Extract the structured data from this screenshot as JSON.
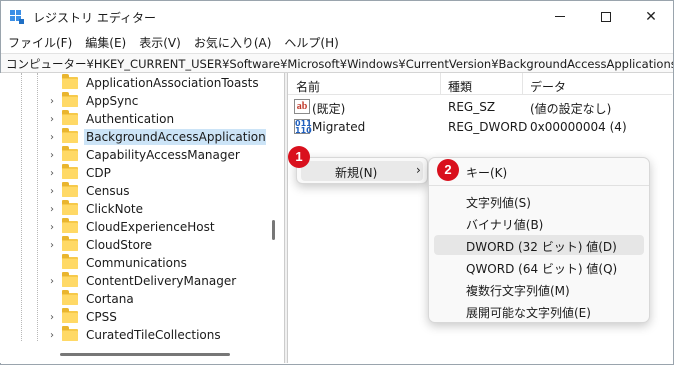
{
  "window": {
    "title": "レジストリ エディター"
  },
  "menubar": {
    "items": [
      "ファイル(F)",
      "編集(E)",
      "表示(V)",
      "お気に入り(A)",
      "ヘルプ(H)"
    ]
  },
  "address": {
    "path": "コンピューター¥HKEY_CURRENT_USER¥Software¥Microsoft¥Windows¥CurrentVersion¥BackgroundAccessApplications"
  },
  "tree": {
    "items": [
      {
        "label": "ApplicationAssociationToasts",
        "expandable": false,
        "selected": false
      },
      {
        "label": "AppSync",
        "expandable": true,
        "selected": false
      },
      {
        "label": "Authentication",
        "expandable": true,
        "selected": false
      },
      {
        "label": "BackgroundAccessApplications",
        "expandable": true,
        "selected": true
      },
      {
        "label": "CapabilityAccessManager",
        "expandable": true,
        "selected": false
      },
      {
        "label": "CDP",
        "expandable": true,
        "selected": false
      },
      {
        "label": "Census",
        "expandable": true,
        "selected": false
      },
      {
        "label": "ClickNote",
        "expandable": true,
        "selected": false
      },
      {
        "label": "CloudExperienceHost",
        "expandable": true,
        "selected": false
      },
      {
        "label": "CloudStore",
        "expandable": true,
        "selected": false
      },
      {
        "label": "Communications",
        "expandable": false,
        "selected": false
      },
      {
        "label": "ContentDeliveryManager",
        "expandable": true,
        "selected": false
      },
      {
        "label": "Cortana",
        "expandable": false,
        "selected": false
      },
      {
        "label": "CPSS",
        "expandable": true,
        "selected": false
      },
      {
        "label": "CuratedTileCollections",
        "expandable": true,
        "selected": false
      }
    ]
  },
  "list": {
    "columns": [
      "名前",
      "種類",
      "データ"
    ],
    "rows": [
      {
        "icon": "string-value-icon",
        "name": "(既定)",
        "type": "REG_SZ",
        "data": "(値の設定なし)"
      },
      {
        "icon": "binary-value-icon",
        "name": "Migrated",
        "type": "REG_DWORD",
        "data": "0x00000004 (4)"
      }
    ]
  },
  "context_menu": {
    "new_label": "新規(N)",
    "arrow": "›",
    "badge1": "1"
  },
  "submenu": {
    "badge2": "2",
    "key_label": "キー(K)",
    "items": [
      "文字列値(S)",
      "バイナリ値(B)",
      "DWORD (32 ビット) 値(D)",
      "QWORD (64 ビット) 値(Q)",
      "複数行文字列値(M)",
      "展開可能な文字列値(E)"
    ],
    "hover_index": 2
  },
  "colors": {
    "selection": "#cce4f7",
    "badge": "#d9101d",
    "folder": "#ffd966"
  }
}
